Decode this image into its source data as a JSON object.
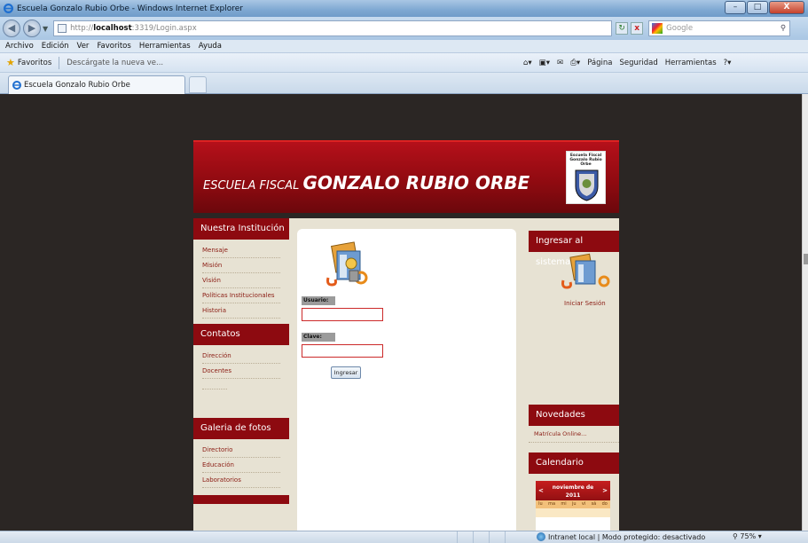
{
  "browser": {
    "window_title": "Escuela Gonzalo Rubio Orbe - Windows Internet Explorer",
    "window_buttons": {
      "minimize": "–",
      "maximize": "□",
      "close": "X"
    },
    "nav": {
      "back": "◀",
      "forward": "▶",
      "dropdown": "▼"
    },
    "url_prefix": "http://",
    "url_host": "localhost",
    "url_rest": ":3319/Login.aspx",
    "url_tools": {
      "refresh": "↻",
      "stop": "x"
    },
    "search_placeholder": "Google",
    "menu": [
      "Archivo",
      "Edición",
      "Ver",
      "Favoritos",
      "Herramientas",
      "Ayuda"
    ],
    "favorites_label": "Favoritos",
    "suggested_site": "Descárgate la nueva ve...",
    "command_bar": [
      "Página",
      "Seguridad",
      "Herramientas"
    ],
    "tab_title": "Escuela Gonzalo Rubio Orbe",
    "status_zone": "Intranet local | Modo protegido: desactivado",
    "zoom": "75%"
  },
  "header": {
    "school_prefix": "ESCUELA FISCAL ",
    "school_name": "GONZALO RUBIO ORBE",
    "emblem_text": "Escuela Fiscal Gonzalo Rubio Orbe"
  },
  "left": {
    "institucion": {
      "title": "Nuestra Institución",
      "links": [
        "Mensaje",
        "Misión",
        "Visión",
        "Políticas Institucionales",
        "Historia"
      ]
    },
    "contactos": {
      "title": "Contatos",
      "links": [
        "Dirección",
        "Docentes"
      ]
    },
    "galeria": {
      "title": "Galeria de fotos",
      "links": [
        "Directorio",
        "Educación",
        "Laboratorios"
      ]
    }
  },
  "login": {
    "usuario_label": "Usuario:",
    "clave_label": "Clave:",
    "button": "Ingresar"
  },
  "right": {
    "ingresar_title": "Ingresar al sistema",
    "iniciar_sesion": "Iniciar Sesión",
    "novedades_title": "Novedades",
    "novedades_link": "Matrícula Online...",
    "calendario_title": "Calendario",
    "calendar_month": "noviembre de",
    "calendar_year": "2011",
    "calendar_days": [
      "lu",
      "ma",
      "mi",
      "ju",
      "vi",
      "sá",
      "do"
    ]
  },
  "colors": {
    "brand_red": "#8d0a10",
    "sidebar_bg": "#e7e2d3",
    "page_bg": "#2b2624"
  }
}
